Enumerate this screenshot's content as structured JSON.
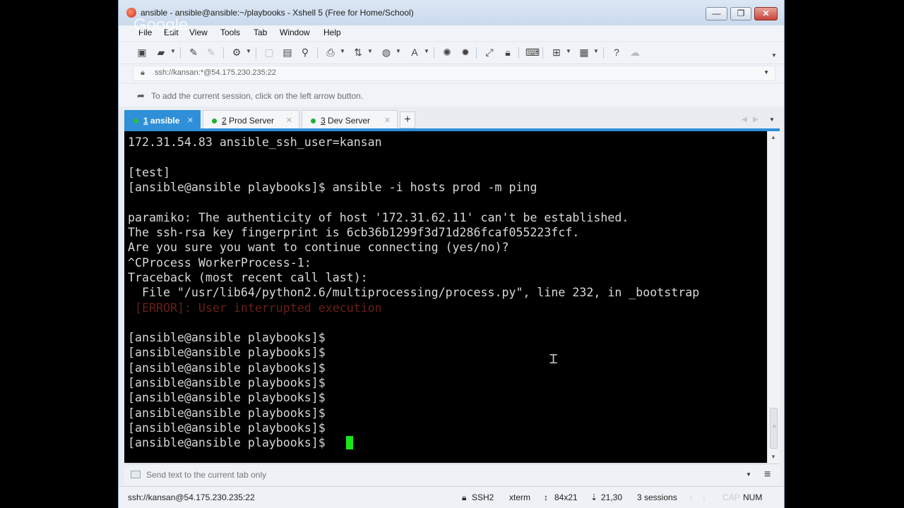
{
  "window": {
    "title": "ansible - ansible@ansible:~/playbooks - Xshell 5 (Free for Home/School)",
    "controls": {
      "minimize": "—",
      "maximize": "❐",
      "close": "✕"
    }
  },
  "watermark": "Google",
  "menu": [
    "File",
    "Edit",
    "View",
    "Tools",
    "Tab",
    "Window",
    "Help"
  ],
  "address": {
    "value": "ssh://kansan:*@54.175.230.235:22"
  },
  "session_hint": "To add the current session, click on the left arrow button.",
  "tabs": [
    {
      "num": "1",
      "label": "ansible",
      "active": true
    },
    {
      "num": "2",
      "label": "Prod Server",
      "active": false
    },
    {
      "num": "3",
      "label": "Dev Server",
      "active": false
    }
  ],
  "tab_add": "+",
  "terminal": {
    "lines": [
      "172.31.54.83 ansible_ssh_user=kansan",
      "",
      "[test]",
      "[ansible@ansible playbooks]$ ansible -i hosts prod -m ping",
      "",
      "paramiko: The authenticity of host '172.31.62.11' can't be established.",
      "The ssh-rsa key fingerprint is 6cb36b1299f3d71d286fcaf055223fcf.",
      "Are you sure you want to continue connecting (yes/no)?",
      "^CProcess WorkerProcess-1:",
      "Traceback (most recent call last):",
      "  File \"/usr/lib64/python2.6/multiprocessing/process.py\", line 232, in _bootstrap",
      " [ERROR]: User interrupted execution",
      "",
      "[ansible@ansible playbooks]$",
      "[ansible@ansible playbooks]$",
      "[ansible@ansible playbooks]$",
      "[ansible@ansible playbooks]$",
      "[ansible@ansible playbooks]$",
      "[ansible@ansible playbooks]$",
      "[ansible@ansible playbooks]$",
      "[ansible@ansible playbooks]$"
    ],
    "error_line_index": 11,
    "cursor_color": "#19e619"
  },
  "compose": {
    "placeholder": "Send text to the current tab only"
  },
  "status": {
    "connection": "ssh://kansan@54.175.230.235:22",
    "protocol": "SSH2",
    "terminal_type": "xterm",
    "size": "84x21",
    "cursor_pos": "21,30",
    "sessions": "3 sessions",
    "caps": "CAP",
    "num": "NUM"
  },
  "colors": {
    "accent": "#2f8fd8",
    "terminal_bg": "#000000",
    "terminal_fg": "#d8d8d8",
    "error": "#c0392b"
  }
}
